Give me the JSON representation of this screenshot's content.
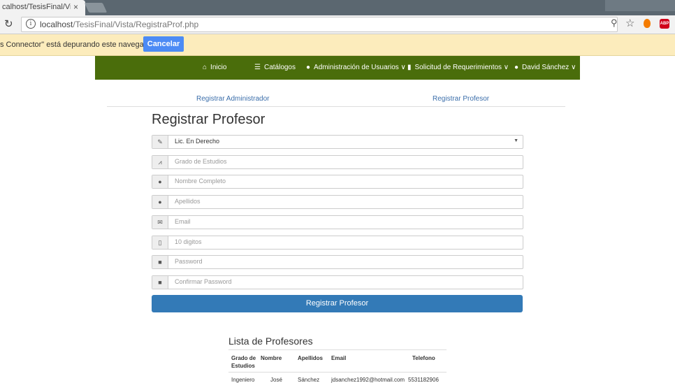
{
  "browser": {
    "tab_title": "calhost/TesisFinal/Vista",
    "tab_close": "×",
    "url_host": "localhost",
    "url_path": "/TesisFinal/Vista/RegistraProf.php",
    "debug_text": "s Connector\" está depurando este navegador.",
    "cancel_label": "Cancelar",
    "abp_label": "ABP"
  },
  "nav": {
    "items": [
      {
        "label": "Inicio",
        "icon": "home-icon"
      },
      {
        "label": "Catálogos",
        "icon": "list-icon"
      },
      {
        "label": "Administración de Usuarios ∨",
        "icon": "user-icon"
      },
      {
        "label": "Solicitud de Requerimientos ∨",
        "icon": "file-icon"
      },
      {
        "label": "David Sánchez ∨",
        "icon": "user-icon"
      }
    ]
  },
  "subtabs": {
    "admin": "Registrar Administrador",
    "profesor": "Registrar Profesor"
  },
  "form": {
    "title": "Registrar Profesor",
    "carrera_value": "Lic. En Derecho",
    "grado_placeholder": "Grado de Estudios",
    "nombre_placeholder": "Nombre Completo",
    "apellidos_placeholder": "Apellidos",
    "email_placeholder": "Email",
    "telefono_placeholder": "10 digitos",
    "password_placeholder": "Password",
    "confirm_placeholder": "Confirmar Password",
    "submit_label": "Registrar Profesor"
  },
  "list": {
    "title": "Lista de Profesores",
    "headers": [
      "Grado de",
      "Estudios",
      "Nombre",
      "Apellidos",
      "Email",
      "Telefono"
    ],
    "rows": [
      [
        "Ingeniero",
        "José",
        "Sánchez",
        "jdsanchez1992@hotmail.com",
        "5531182906"
      ]
    ]
  }
}
